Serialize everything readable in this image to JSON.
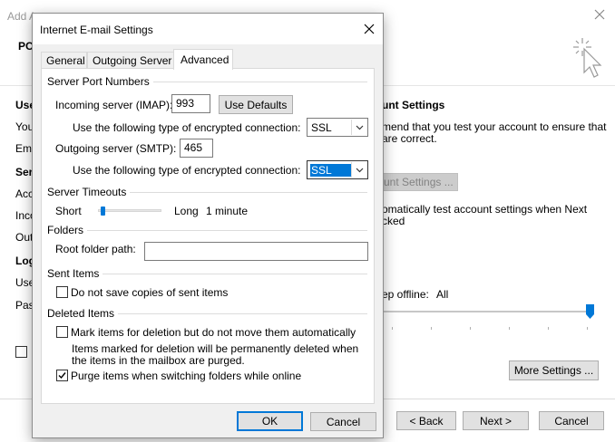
{
  "background_window": {
    "title": "Add Account",
    "left_partial": [
      "POP",
      "Use",
      "You",
      "Ema",
      "Serv",
      "Acc",
      "Inco",
      "Out",
      "Log",
      "Use",
      "Pas"
    ],
    "right_heading": "unt Settings",
    "right_text_line1": "mend that you test your account to ensure that",
    "right_text_line2": "are correct.",
    "test_button_label": "unt Settings ...",
    "auto_test_line1": "omatically test account settings when Next",
    "auto_test_line2": "cked",
    "keep_offline_label": "ep offline:",
    "keep_offline_value": "All",
    "more_settings_label": "More Settings ...",
    "back_label": "< Back",
    "next_label": "Next >",
    "cancel_label": "Cancel"
  },
  "dialog": {
    "title": "Internet E-mail Settings",
    "tabs": [
      {
        "label": "General",
        "active": false
      },
      {
        "label": "Outgoing Server",
        "active": false
      },
      {
        "label": "Advanced",
        "active": true
      }
    ],
    "server_port": {
      "section_label": "Server Port Numbers",
      "incoming_label": "Incoming server (IMAP):",
      "incoming_value": "993",
      "use_defaults_label": "Use Defaults",
      "incoming_enc_label": "Use the following type of encrypted connection:",
      "incoming_enc_value": "SSL",
      "outgoing_label": "Outgoing server (SMTP):",
      "outgoing_value": "465",
      "outgoing_enc_label": "Use the following type of encrypted connection:",
      "outgoing_enc_value": "SSL"
    },
    "timeouts": {
      "section_label": "Server Timeouts",
      "short_label": "Short",
      "long_label": "Long",
      "value_label": "1 minute",
      "slider_position": 0.05
    },
    "folders": {
      "section_label": "Folders",
      "root_label": "Root folder path:",
      "root_value": ""
    },
    "sent_items": {
      "section_label": "Sent Items",
      "no_copies_label": "Do not save copies of sent items",
      "no_copies_checked": false
    },
    "deleted_items": {
      "section_label": "Deleted Items",
      "mark_label": "Mark items for deletion but do not move them automatically",
      "mark_checked": false,
      "info_line1": "Items marked for deletion will be permanently deleted when",
      "info_line2": "the items in the mailbox are purged.",
      "purge_label": "Purge items when switching folders while online",
      "purge_checked": true
    },
    "ok_label": "OK",
    "cancel_label": "Cancel"
  }
}
